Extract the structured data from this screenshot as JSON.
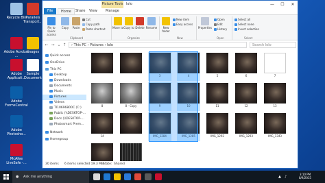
{
  "desktop": {
    "icons": [
      {
        "label": "Recycle Bin",
        "color": "#9ec3e6"
      },
      {
        "label": "Parallels Transport...",
        "color": "#d23a2a"
      },
      {
        "label": "Adobe Acrobat ...",
        "color": "#c8102e"
      },
      {
        "label": "images",
        "color": "#f2c200"
      },
      {
        "label": "Adobe Applicati...",
        "color": "#c8102e"
      },
      {
        "label": "Sample Document",
        "color": "#ffffff"
      },
      {
        "label": "Adobe FormsCentral",
        "color": "#0b5ea8"
      },
      {
        "label": "Adobe Photosho...",
        "color": "#0b5ea8"
      },
      {
        "label": "McAfee LiveSafe -...",
        "color": "#c8102e"
      }
    ]
  },
  "window": {
    "context_tab": "Picture Tools",
    "title": "lolo",
    "controls": [
      "—",
      "☐",
      "✕"
    ],
    "tabs": [
      "File",
      "Home",
      "Share",
      "View",
      "Manage"
    ],
    "ribbon": {
      "groups": [
        "Clipboard",
        "Organize",
        "New",
        "Open",
        "Select"
      ],
      "pin_label": "Pin to Quick access",
      "copy_label": "Copy",
      "paste_label": "Paste",
      "cut_label": "Cut",
      "copy_path_label": "Copy path",
      "paste_shortcut_label": "Paste shortcut",
      "move_to_label": "Move to",
      "copy_to_label": "Copy to",
      "delete_label": "Delete",
      "rename_label": "Rename",
      "new_folder_label": "New folder",
      "new_item_label": "New item",
      "easy_access_label": "Easy access",
      "properties_label": "Properties",
      "open_label": "Open",
      "edit_label": "Edit",
      "history_label": "History",
      "select_all_label": "Select all",
      "select_none_label": "Select none",
      "invert_selection_label": "Invert selection"
    },
    "address": {
      "path": "›  This PC  ›  Pictures  ›  lolo",
      "search_placeholder": "Search lolo"
    },
    "nav_items": [
      {
        "label": "Quick access",
        "color": "#3a8ee6"
      },
      {
        "label": "OneDrive",
        "color": "#3a8ee6"
      },
      {
        "label": "This PC",
        "color": "#5aa0e0"
      },
      {
        "label": "Desktop",
        "color": "#3a8ee6"
      },
      {
        "label": "Downloads",
        "color": "#3a8ee6"
      },
      {
        "label": "Documents",
        "color": "#9aa8b8"
      },
      {
        "label": "Music",
        "color": "#3a8ee6"
      },
      {
        "label": "Pictures",
        "color": "#3a8ee6",
        "selected": true
      },
      {
        "label": "Videos",
        "color": "#3a8ee6"
      },
      {
        "label": "TI10696800C (C:)",
        "color": "#9aa8b8"
      },
      {
        "label": "Public (\\\\DESKTOP-...",
        "color": "#7aa45a"
      },
      {
        "label": "Docs (\\\\DESKTOP-...",
        "color": "#7aa45a"
      },
      {
        "label": "Photosmart Prem...",
        "color": "#9aa8b8"
      },
      {
        "label": "Network",
        "color": "#3a8ee6"
      },
      {
        "label": "Homegroup",
        "color": "#3a8ee6"
      }
    ],
    "tiles": [
      {
        "caption": "",
        "style": "dark"
      },
      {
        "caption": "",
        "style": "dark"
      },
      {
        "caption": "3",
        "style": "dark",
        "selected": true
      },
      {
        "caption": "4",
        "style": "dark",
        "selected": true
      },
      {
        "caption": "5",
        "style": "dark"
      },
      {
        "caption": "6",
        "style": "dark"
      },
      {
        "caption": "7",
        "style": "blank"
      },
      {
        "caption": "8",
        "style": "light"
      },
      {
        "caption": "8 - Copy",
        "style": "light"
      },
      {
        "caption": "9",
        "style": "dark",
        "selected": true
      },
      {
        "caption": "10",
        "style": "dark",
        "selected": true
      },
      {
        "caption": "11",
        "style": "dark"
      },
      {
        "caption": "12",
        "style": "dark"
      },
      {
        "caption": "13",
        "style": "dark"
      },
      {
        "caption": "14",
        "style": "dark"
      },
      {
        "caption": "",
        "style": "dark"
      },
      {
        "caption": "IMG_1284",
        "style": "dark",
        "selected": true
      },
      {
        "caption": "IMG_1285",
        "style": "dark",
        "selected": true
      },
      {
        "caption": "IMG_1292",
        "style": "dark"
      },
      {
        "caption": "IMG_1293",
        "style": "dark"
      },
      {
        "caption": "IMG_1343",
        "style": "dark"
      },
      {
        "caption": "",
        "style": "dark"
      },
      {
        "caption": "",
        "style": "film"
      }
    ],
    "status": {
      "items": "30 items",
      "selected": "6 items selected  19.3 MB",
      "state": "State:",
      "shared": "Shared"
    }
  },
  "taskbar": {
    "search_text": "Ask me anything",
    "apps": [
      {
        "name": "task-view",
        "color": "#d9d9d9"
      },
      {
        "name": "edge",
        "color": "#1f78d1"
      },
      {
        "name": "file-explorer",
        "color": "#f2c200"
      },
      {
        "name": "store",
        "color": "#2b7ad9"
      },
      {
        "name": "chrome",
        "color": "#e04a3a"
      },
      {
        "name": "calculator",
        "color": "#5a5a5a"
      },
      {
        "name": "acrobat",
        "color": "#c8102e"
      }
    ],
    "time": "3:10 PM",
    "date": "8/9/2015"
  }
}
